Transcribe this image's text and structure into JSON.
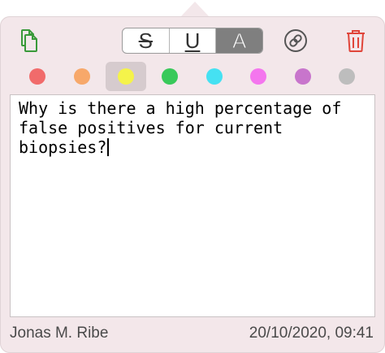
{
  "toolbar": {
    "format_buttons": [
      {
        "label": "S",
        "name": "strikethrough"
      },
      {
        "label": "U",
        "name": "underline"
      },
      {
        "label": "A",
        "name": "text-color"
      }
    ],
    "icons": {
      "copy": "copy-icon",
      "link": "link-icon",
      "trash": "trash-icon"
    },
    "icon_colors": {
      "copy": "#3a9a3a",
      "link": "#555555",
      "trash": "#e0453a"
    }
  },
  "colors": [
    {
      "name": "red",
      "hex": "#f16b6b"
    },
    {
      "name": "orange",
      "hex": "#f7a86a"
    },
    {
      "name": "yellow",
      "hex": "#f5f34a",
      "selected": true
    },
    {
      "name": "green",
      "hex": "#39c95a"
    },
    {
      "name": "cyan",
      "hex": "#45e1f2"
    },
    {
      "name": "pink",
      "hex": "#f476ee"
    },
    {
      "name": "purple",
      "hex": "#c875cc"
    },
    {
      "name": "gray",
      "hex": "#bdbdbd"
    }
  ],
  "note": {
    "text": "Why is there a high percentage of false positives for current biopsies?"
  },
  "footer": {
    "author": "Jonas M. Ribe",
    "timestamp": "20/10/2020, 09:41"
  }
}
